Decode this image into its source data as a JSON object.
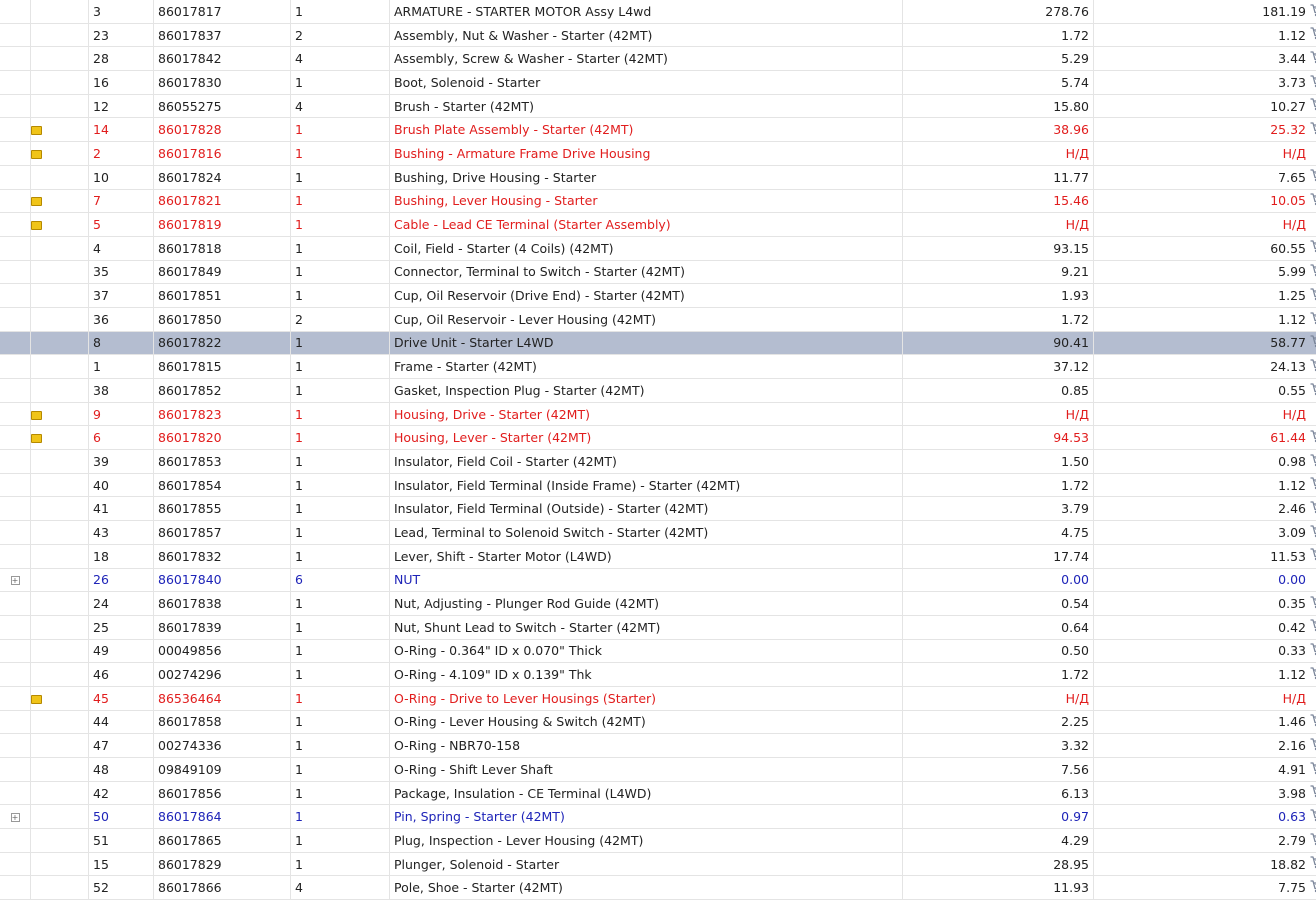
{
  "icons": {
    "note": "note-icon",
    "expand": "expand-plus-icon",
    "cart": "cart-icon"
  },
  "colors": {
    "unavailable": "#e11d1d",
    "group": "#1e24b8",
    "selected_row": "#b4bdd0"
  },
  "rows": [
    {
      "ref": "3",
      "part": "86017817",
      "qty": "1",
      "desc": "ARMATURE - STARTER MOTOR Assy L4wd",
      "price": "278.76",
      "net": "181.19",
      "status": "normal",
      "icon": "",
      "cart": true
    },
    {
      "ref": "23",
      "part": "86017837",
      "qty": "2",
      "desc": "Assembly, Nut & Washer - Starter (42MT)",
      "price": "1.72",
      "net": "1.12",
      "status": "normal",
      "icon": "",
      "cart": true
    },
    {
      "ref": "28",
      "part": "86017842",
      "qty": "4",
      "desc": "Assembly, Screw & Washer - Starter (42MT)",
      "price": "5.29",
      "net": "3.44",
      "status": "normal",
      "icon": "",
      "cart": true
    },
    {
      "ref": "16",
      "part": "86017830",
      "qty": "1",
      "desc": "Boot, Solenoid - Starter",
      "price": "5.74",
      "net": "3.73",
      "status": "normal",
      "icon": "",
      "cart": true
    },
    {
      "ref": "12",
      "part": "86055275",
      "qty": "4",
      "desc": "Brush - Starter (42MT)",
      "price": "15.80",
      "net": "10.27",
      "status": "normal",
      "icon": "",
      "cart": true
    },
    {
      "ref": "14",
      "part": "86017828",
      "qty": "1",
      "desc": "Brush Plate Assembly - Starter (42MT)",
      "price": "38.96",
      "net": "25.32",
      "status": "red",
      "icon": "note",
      "cart": true
    },
    {
      "ref": "2",
      "part": "86017816",
      "qty": "1",
      "desc": "Bushing - Armature Frame Drive Housing",
      "price": "Н/Д",
      "net": "Н/Д",
      "status": "red",
      "icon": "note",
      "cart": false
    },
    {
      "ref": "10",
      "part": "86017824",
      "qty": "1",
      "desc": "Bushing, Drive Housing - Starter",
      "price": "11.77",
      "net": "7.65",
      "status": "normal",
      "icon": "",
      "cart": true
    },
    {
      "ref": "7",
      "part": "86017821",
      "qty": "1",
      "desc": "Bushing, Lever Housing - Starter",
      "price": "15.46",
      "net": "10.05",
      "status": "red",
      "icon": "note",
      "cart": true
    },
    {
      "ref": "5",
      "part": "86017819",
      "qty": "1",
      "desc": "Cable - Lead CE Terminal (Starter Assembly)",
      "price": "Н/Д",
      "net": "Н/Д",
      "status": "red",
      "icon": "note",
      "cart": false
    },
    {
      "ref": "4",
      "part": "86017818",
      "qty": "1",
      "desc": "Coil, Field - Starter (4 Coils) (42MT)",
      "price": "93.15",
      "net": "60.55",
      "status": "normal",
      "icon": "",
      "cart": true
    },
    {
      "ref": "35",
      "part": "86017849",
      "qty": "1",
      "desc": "Connector, Terminal to Switch - Starter (42MT)",
      "price": "9.21",
      "net": "5.99",
      "status": "normal",
      "icon": "",
      "cart": true
    },
    {
      "ref": "37",
      "part": "86017851",
      "qty": "1",
      "desc": "Cup, Oil Reservoir (Drive End) - Starter (42MT)",
      "price": "1.93",
      "net": "1.25",
      "status": "normal",
      "icon": "",
      "cart": true
    },
    {
      "ref": "36",
      "part": "86017850",
      "qty": "2",
      "desc": "Cup, Oil Reservoir - Lever Housing (42MT)",
      "price": "1.72",
      "net": "1.12",
      "status": "normal",
      "icon": "",
      "cart": true
    },
    {
      "ref": "8",
      "part": "86017822",
      "qty": "1",
      "desc": "Drive Unit - Starter L4WD",
      "price": "90.41",
      "net": "58.77",
      "status": "selected",
      "icon": "",
      "cart": true
    },
    {
      "ref": "1",
      "part": "86017815",
      "qty": "1",
      "desc": "Frame - Starter (42MT)",
      "price": "37.12",
      "net": "24.13",
      "status": "normal",
      "icon": "",
      "cart": true
    },
    {
      "ref": "38",
      "part": "86017852",
      "qty": "1",
      "desc": "Gasket, Inspection Plug - Starter (42MT)",
      "price": "0.85",
      "net": "0.55",
      "status": "normal",
      "icon": "",
      "cart": true
    },
    {
      "ref": "9",
      "part": "86017823",
      "qty": "1",
      "desc": "Housing, Drive - Starter (42MT)",
      "price": "Н/Д",
      "net": "Н/Д",
      "status": "red",
      "icon": "note",
      "cart": false
    },
    {
      "ref": "6",
      "part": "86017820",
      "qty": "1",
      "desc": "Housing, Lever - Starter (42MT)",
      "price": "94.53",
      "net": "61.44",
      "status": "red",
      "icon": "note",
      "cart": true
    },
    {
      "ref": "39",
      "part": "86017853",
      "qty": "1",
      "desc": "Insulator, Field Coil - Starter (42MT)",
      "price": "1.50",
      "net": "0.98",
      "status": "normal",
      "icon": "",
      "cart": true
    },
    {
      "ref": "40",
      "part": "86017854",
      "qty": "1",
      "desc": "Insulator, Field Terminal (Inside Frame) - Starter (42MT)",
      "price": "1.72",
      "net": "1.12",
      "status": "normal",
      "icon": "",
      "cart": true
    },
    {
      "ref": "41",
      "part": "86017855",
      "qty": "1",
      "desc": "Insulator, Field Terminal (Outside) - Starter (42MT)",
      "price": "3.79",
      "net": "2.46",
      "status": "normal",
      "icon": "",
      "cart": true
    },
    {
      "ref": "43",
      "part": "86017857",
      "qty": "1",
      "desc": "Lead, Terminal to Solenoid Switch - Starter (42MT)",
      "price": "4.75",
      "net": "3.09",
      "status": "normal",
      "icon": "",
      "cart": true
    },
    {
      "ref": "18",
      "part": "86017832",
      "qty": "1",
      "desc": "Lever, Shift - Starter Motor (L4WD)",
      "price": "17.74",
      "net": "11.53",
      "status": "normal",
      "icon": "",
      "cart": true
    },
    {
      "ref": "26",
      "part": "86017840",
      "qty": "6",
      "desc": "NUT",
      "price": "0.00",
      "net": "0.00",
      "status": "blue",
      "icon": "expand",
      "cart": false
    },
    {
      "ref": "24",
      "part": "86017838",
      "qty": "1",
      "desc": "Nut, Adjusting - Plunger Rod Guide (42MT)",
      "price": "0.54",
      "net": "0.35",
      "status": "normal",
      "icon": "",
      "cart": true
    },
    {
      "ref": "25",
      "part": "86017839",
      "qty": "1",
      "desc": "Nut, Shunt Lead to Switch - Starter (42MT)",
      "price": "0.64",
      "net": "0.42",
      "status": "normal",
      "icon": "",
      "cart": true
    },
    {
      "ref": "49",
      "part": "00049856",
      "qty": "1",
      "desc": "O-Ring - 0.364\" ID x 0.070\" Thick",
      "price": "0.50",
      "net": "0.33",
      "status": "normal",
      "icon": "",
      "cart": true
    },
    {
      "ref": "46",
      "part": "00274296",
      "qty": "1",
      "desc": "O-Ring - 4.109\" ID x 0.139\" Thk",
      "price": "1.72",
      "net": "1.12",
      "status": "normal",
      "icon": "",
      "cart": true
    },
    {
      "ref": "45",
      "part": "86536464",
      "qty": "1",
      "desc": "O-Ring - Drive to Lever Housings (Starter)",
      "price": "Н/Д",
      "net": "Н/Д",
      "status": "red",
      "icon": "note",
      "cart": false
    },
    {
      "ref": "44",
      "part": "86017858",
      "qty": "1",
      "desc": "O-Ring - Lever Housing & Switch (42MT)",
      "price": "2.25",
      "net": "1.46",
      "status": "normal",
      "icon": "",
      "cart": true
    },
    {
      "ref": "47",
      "part": "00274336",
      "qty": "1",
      "desc": "O-Ring - NBR70-158",
      "price": "3.32",
      "net": "2.16",
      "status": "normal",
      "icon": "",
      "cart": true
    },
    {
      "ref": "48",
      "part": "09849109",
      "qty": "1",
      "desc": "O-Ring - Shift Lever Shaft",
      "price": "7.56",
      "net": "4.91",
      "status": "normal",
      "icon": "",
      "cart": true
    },
    {
      "ref": "42",
      "part": "86017856",
      "qty": "1",
      "desc": "Package, Insulation - CE Terminal (L4WD)",
      "price": "6.13",
      "net": "3.98",
      "status": "normal",
      "icon": "",
      "cart": true
    },
    {
      "ref": "50",
      "part": "86017864",
      "qty": "1",
      "desc": "Pin, Spring - Starter (42MT)",
      "price": "0.97",
      "net": "0.63",
      "status": "blue",
      "icon": "expand",
      "cart": true
    },
    {
      "ref": "51",
      "part": "86017865",
      "qty": "1",
      "desc": "Plug, Inspection - Lever Housing (42MT)",
      "price": "4.29",
      "net": "2.79",
      "status": "normal",
      "icon": "",
      "cart": true
    },
    {
      "ref": "15",
      "part": "86017829",
      "qty": "1",
      "desc": "Plunger, Solenoid - Starter",
      "price": "28.95",
      "net": "18.82",
      "status": "normal",
      "icon": "",
      "cart": true
    },
    {
      "ref": "52",
      "part": "86017866",
      "qty": "4",
      "desc": "Pole, Shoe - Starter (42MT)",
      "price": "11.93",
      "net": "7.75",
      "status": "normal",
      "icon": "",
      "cart": true
    }
  ]
}
